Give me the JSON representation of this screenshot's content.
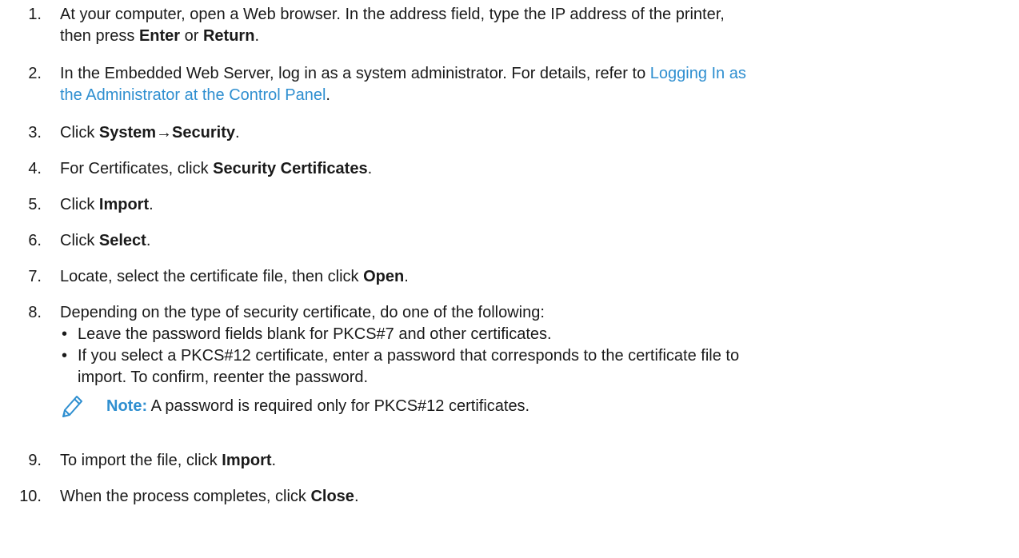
{
  "steps": [
    {
      "num": "1.",
      "pre": "At your computer, open a Web browser. In the address field, type the IP address of the printer,",
      "line2_pre": "then press ",
      "b1": "Enter",
      "mid": " or ",
      "b2": "Return",
      "post": "."
    },
    {
      "num": "2.",
      "pre": "In the Embedded Web Server, log in as a system administrator. For details, refer to ",
      "link1": "Logging In as",
      "link2": "the Administrator at the Control Panel",
      "post": "."
    },
    {
      "num": "3.",
      "pre": "Click ",
      "b1": "System",
      "arrow": "→",
      "b2": "Security",
      "post": "."
    },
    {
      "num": "4.",
      "pre": "For Certificates, click ",
      "b1": "Security Certificates",
      "post": "."
    },
    {
      "num": "5.",
      "pre": "Click ",
      "b1": "Import",
      "post": "."
    },
    {
      "num": "6.",
      "pre": "Click ",
      "b1": "Select",
      "post": "."
    },
    {
      "num": "7.",
      "pre": "Locate, select the certificate file, then click ",
      "b1": "Open",
      "post": "."
    },
    {
      "num": "8.",
      "pre": "Depending on the type of security certificate, do one of the following:",
      "bullets": [
        "Leave the password fields blank for PKCS#7 and other certificates.",
        "If you select a PKCS#12 certificate, enter a password that corresponds to the certificate file to",
        "import. To confirm, reenter the password."
      ],
      "bullet_char": "•"
    },
    {
      "num": "9.",
      "pre": "To import the file, click ",
      "b1": "Import",
      "post": "."
    },
    {
      "num": "10.",
      "pre": "When the process completes, click ",
      "b1": "Close",
      "post": "."
    }
  ],
  "note": {
    "label": "Note:",
    "text": " A password is required only for PKCS#12 certificates.",
    "icon": "pencil-icon"
  },
  "colors": {
    "link": "#2f8fd0",
    "text": "#1a1a1a"
  }
}
